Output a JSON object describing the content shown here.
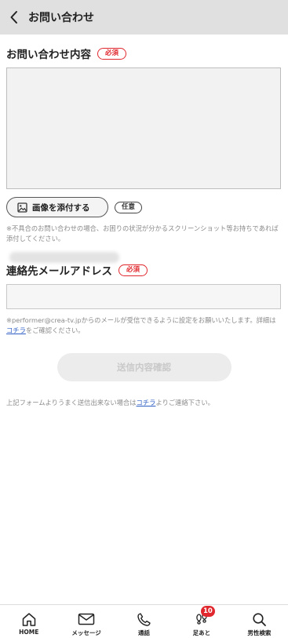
{
  "header": {
    "title": "お問い合わせ"
  },
  "inquiry": {
    "label": "お問い合わせ内容",
    "required_badge": "必須",
    "textarea_value": "",
    "attach_button_label": "画像を添付する",
    "optional_badge": "任意",
    "attach_note": "※不具合のお問い合わせの場合、お困りの状況が分かるスクリーンショット等お持ちであれば添付してください。"
  },
  "email": {
    "label": "連絡先メールアドレス",
    "required_badge": "必須",
    "value": "",
    "note_before": "※performer@crea-tv.jpからのメールが受信できるように設定をお願いいたします。詳細は",
    "note_link": "コチラ",
    "note_after": "をご確認ください。"
  },
  "submit": {
    "label": "送信内容確認"
  },
  "footer_note": {
    "before": "上記フォームよりうまく送信出来ない場合は",
    "link": "コチラ",
    "after": "よりご連絡下さい。"
  },
  "bottom_nav": {
    "items": [
      {
        "label": "HOME",
        "icon": "home-icon"
      },
      {
        "label": "メッセージ",
        "icon": "envelope-icon"
      },
      {
        "label": "通話",
        "icon": "phone-icon"
      },
      {
        "label": "足あと",
        "icon": "footprint-icon",
        "badge": "10"
      },
      {
        "label": "男性検索",
        "icon": "search-icon"
      }
    ]
  },
  "colors": {
    "required": "#e0282e",
    "link": "#2f5fc4",
    "header_bg": "#e0e0e0"
  }
}
